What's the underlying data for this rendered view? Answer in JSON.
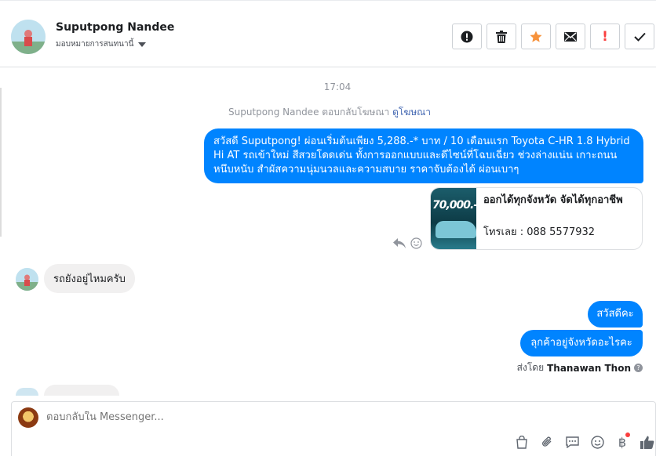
{
  "header": {
    "contact_name": "Suputpong Nandee",
    "assign_label": "มอบหมายการสนทนานี้",
    "actions": [
      {
        "name": "report-spam-button",
        "icon": "exclamation-circle-icon"
      },
      {
        "name": "delete-button",
        "icon": "trash-icon"
      },
      {
        "name": "star-button",
        "icon": "star-icon"
      },
      {
        "name": "mark-unread-button",
        "icon": "envelope-icon"
      },
      {
        "name": "mark-important-button",
        "icon": "exclamation-icon",
        "label": "!"
      },
      {
        "name": "mark-done-button",
        "icon": "check-icon"
      }
    ]
  },
  "conversation": {
    "timestamp": "17:04",
    "reply_note_prefix": "Suputpong Nandee ตอบกลับโฆษณา",
    "reply_note_link": "ดูโฆษณา",
    "outgoing_ad_message": "สวัสดี Suputpong! ผ่อนเริ่มต้นเพียง 5,288.-* บาท / 10 เดือนแรก Toyota C-HR 1.8 Hybrid Hi AT รถเข้าใหม่ สีสวยโดดเด่น ทั้งการออกแบบและดีไซน์ที่โฉบเฉี่ยว ช่วงล่างแน่น เกาะถนน หนึบหนับ สำผัสความนุ่มนวลและความสบาย ราคาจับต้องได้ ผ่อนเบาๆ",
    "ad_card": {
      "thumb_text": "70,000.-",
      "title": "ออกได้ทุกจังหวัด จัดได้ทุกอาชีพ",
      "phone": "โทรเลย : 088 5577932"
    },
    "incoming_message": "รถยังอยู่ไหมครับ",
    "outgoing_reply_1": "สวัสดีคะ",
    "outgoing_reply_2": "ลุกค้าอยู่จังหวัดอะไรคะ",
    "sent_by_prefix": "ส่งโดย",
    "sent_by_name": "Thanawan Thon"
  },
  "composer": {
    "placeholder": "ตอบกลับใน Messenger...",
    "tools": [
      "bag-icon",
      "paperclip-icon",
      "saved-reply-icon",
      "emoji-icon",
      "baht-icon",
      "like-icon"
    ]
  },
  "colors": {
    "outgoing_bubble": "#0084ff",
    "incoming_bubble": "#f1f0f0",
    "star_orange": "#f7923b",
    "important_red": "#fa3e3e",
    "link_blue": "#4267b2"
  }
}
